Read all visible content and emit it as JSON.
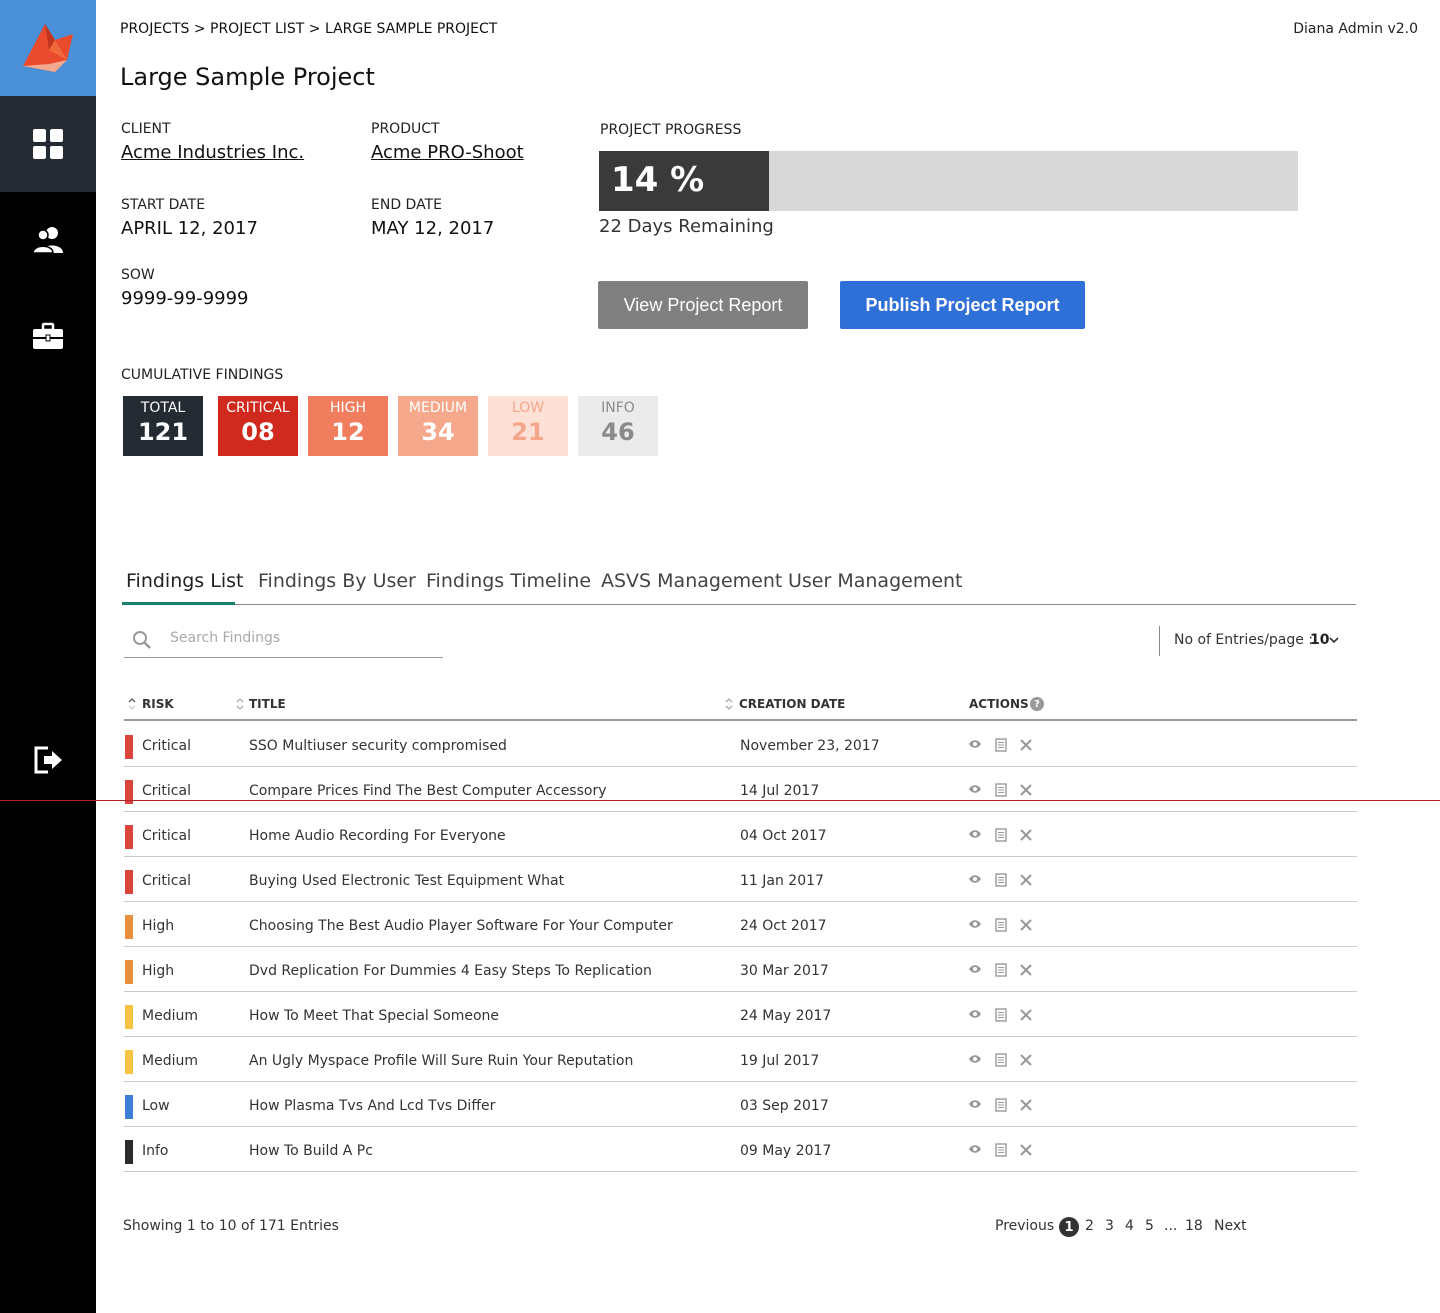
{
  "colors": {
    "sidebar_bg": "#000000",
    "logo_bg": "#4a90d9",
    "active_nav": "#242b33",
    "publish_button": "#2f6fd8",
    "view_button": "#808080",
    "tab_underline": "#1a7f6e",
    "critical": "#d9453a",
    "high": "#e8903c",
    "medium": "#f6c342",
    "low": "#3f7ed6",
    "info": "#2b2b2b"
  },
  "sidebar": {
    "logo_icon": "fox-logo-icon",
    "items": [
      {
        "icon": "dashboard-grid-icon",
        "active": true
      },
      {
        "icon": "users-icon",
        "active": false
      },
      {
        "icon": "briefcase-icon",
        "active": false
      },
      {
        "icon": "logout-icon",
        "active": false
      }
    ]
  },
  "header": {
    "breadcrumb": "PROJECTS > PROJECT LIST > LARGE SAMPLE PROJECT",
    "version": "Diana Admin v2.0",
    "title": "Large Sample Project"
  },
  "details": {
    "client_label": "CLIENT",
    "client_value": "Acme Industries Inc.",
    "product_label": "PRODUCT",
    "product_value": "Acme PRO-Shoot",
    "start_label": "START DATE",
    "start_value": "APRIL 12, 2017",
    "end_label": "END DATE",
    "end_value": "MAY 12, 2017",
    "sow_label": "SOW",
    "sow_value": "9999-99-9999"
  },
  "progress": {
    "label": "PROJECT PROGRESS",
    "percent": 14,
    "percent_text": "14 %",
    "days_remaining": "22 Days Remaining"
  },
  "buttons": {
    "view_report": "View Project Report",
    "publish_report": "Publish  Project Report"
  },
  "cumulative": {
    "label": "CUMULATIVE FINDINGS",
    "boxes": [
      {
        "label": "TOTAL",
        "value": "121",
        "bg": "#242b33",
        "fg": "#ffffff"
      },
      {
        "label": "CRITICAL",
        "value": "08",
        "bg": "#d02a1e",
        "fg": "#ffffff"
      },
      {
        "label": "HIGH",
        "value": "12",
        "bg": "#f07e5e",
        "fg": "#ffffff"
      },
      {
        "label": "MEDIUM",
        "value": "34",
        "bg": "#f6a88c",
        "fg": "#ffffff"
      },
      {
        "label": "LOW",
        "value": "21",
        "bg": "#fde1d6",
        "fg": "#f4a58a"
      },
      {
        "label": "INFO",
        "value": "46",
        "bg": "#ebebeb",
        "fg": "#8a8a8a"
      }
    ]
  },
  "tabs": [
    {
      "label": "Findings List",
      "active": true
    },
    {
      "label": "Findings By User",
      "active": false
    },
    {
      "label": "Findings Timeline",
      "active": false
    },
    {
      "label": "ASVS Management",
      "active": false
    },
    {
      "label": "User Management",
      "active": false
    }
  ],
  "search": {
    "placeholder": "Search Findings",
    "value": ""
  },
  "entries": {
    "label": "No of Entries/page :",
    "value": "10"
  },
  "table": {
    "columns": {
      "risk": "RISK",
      "title": "TITLE",
      "date": "CREATION DATE",
      "actions": "ACTIONS"
    },
    "rows": [
      {
        "risk": "Critical",
        "title": "SSO Multiuser security compromised",
        "date": "November 23, 2017"
      },
      {
        "risk": "Critical",
        "title": "Compare Prices Find The Best Computer Accessory",
        "date": "14 Jul 2017"
      },
      {
        "risk": "Critical",
        "title": "Home Audio Recording For Everyone",
        "date": "04 Oct 2017"
      },
      {
        "risk": "Critical",
        "title": "Buying Used Electronic Test Equipment What",
        "date": "11 Jan 2017"
      },
      {
        "risk": "High",
        "title": "Choosing The Best Audio Player Software For Your Computer",
        "date": "24 Oct 2017"
      },
      {
        "risk": "High",
        "title": "Dvd Replication For Dummies 4 Easy Steps To Replication",
        "date": "30 Mar 2017"
      },
      {
        "risk": "Medium",
        "title": "How To Meet That Special Someone",
        "date": "24 May 2017"
      },
      {
        "risk": "Medium",
        "title": "An Ugly Myspace Profile Will Sure Ruin Your Reputation",
        "date": "19 Jul 2017"
      },
      {
        "risk": "Low",
        "title": "How Plasma Tvs And Lcd Tvs Differ",
        "date": "03 Sep 2017"
      },
      {
        "risk": "Info",
        "title": "How To Build A Pc",
        "date": "09 May 2017"
      }
    ]
  },
  "footer": {
    "showing": "Showing 1 to 10 of 171 Entries",
    "previous": "Previous",
    "pages": [
      "1",
      "2",
      "3",
      "4",
      "5",
      "...",
      "18"
    ],
    "current_page": "1",
    "next": "Next"
  }
}
